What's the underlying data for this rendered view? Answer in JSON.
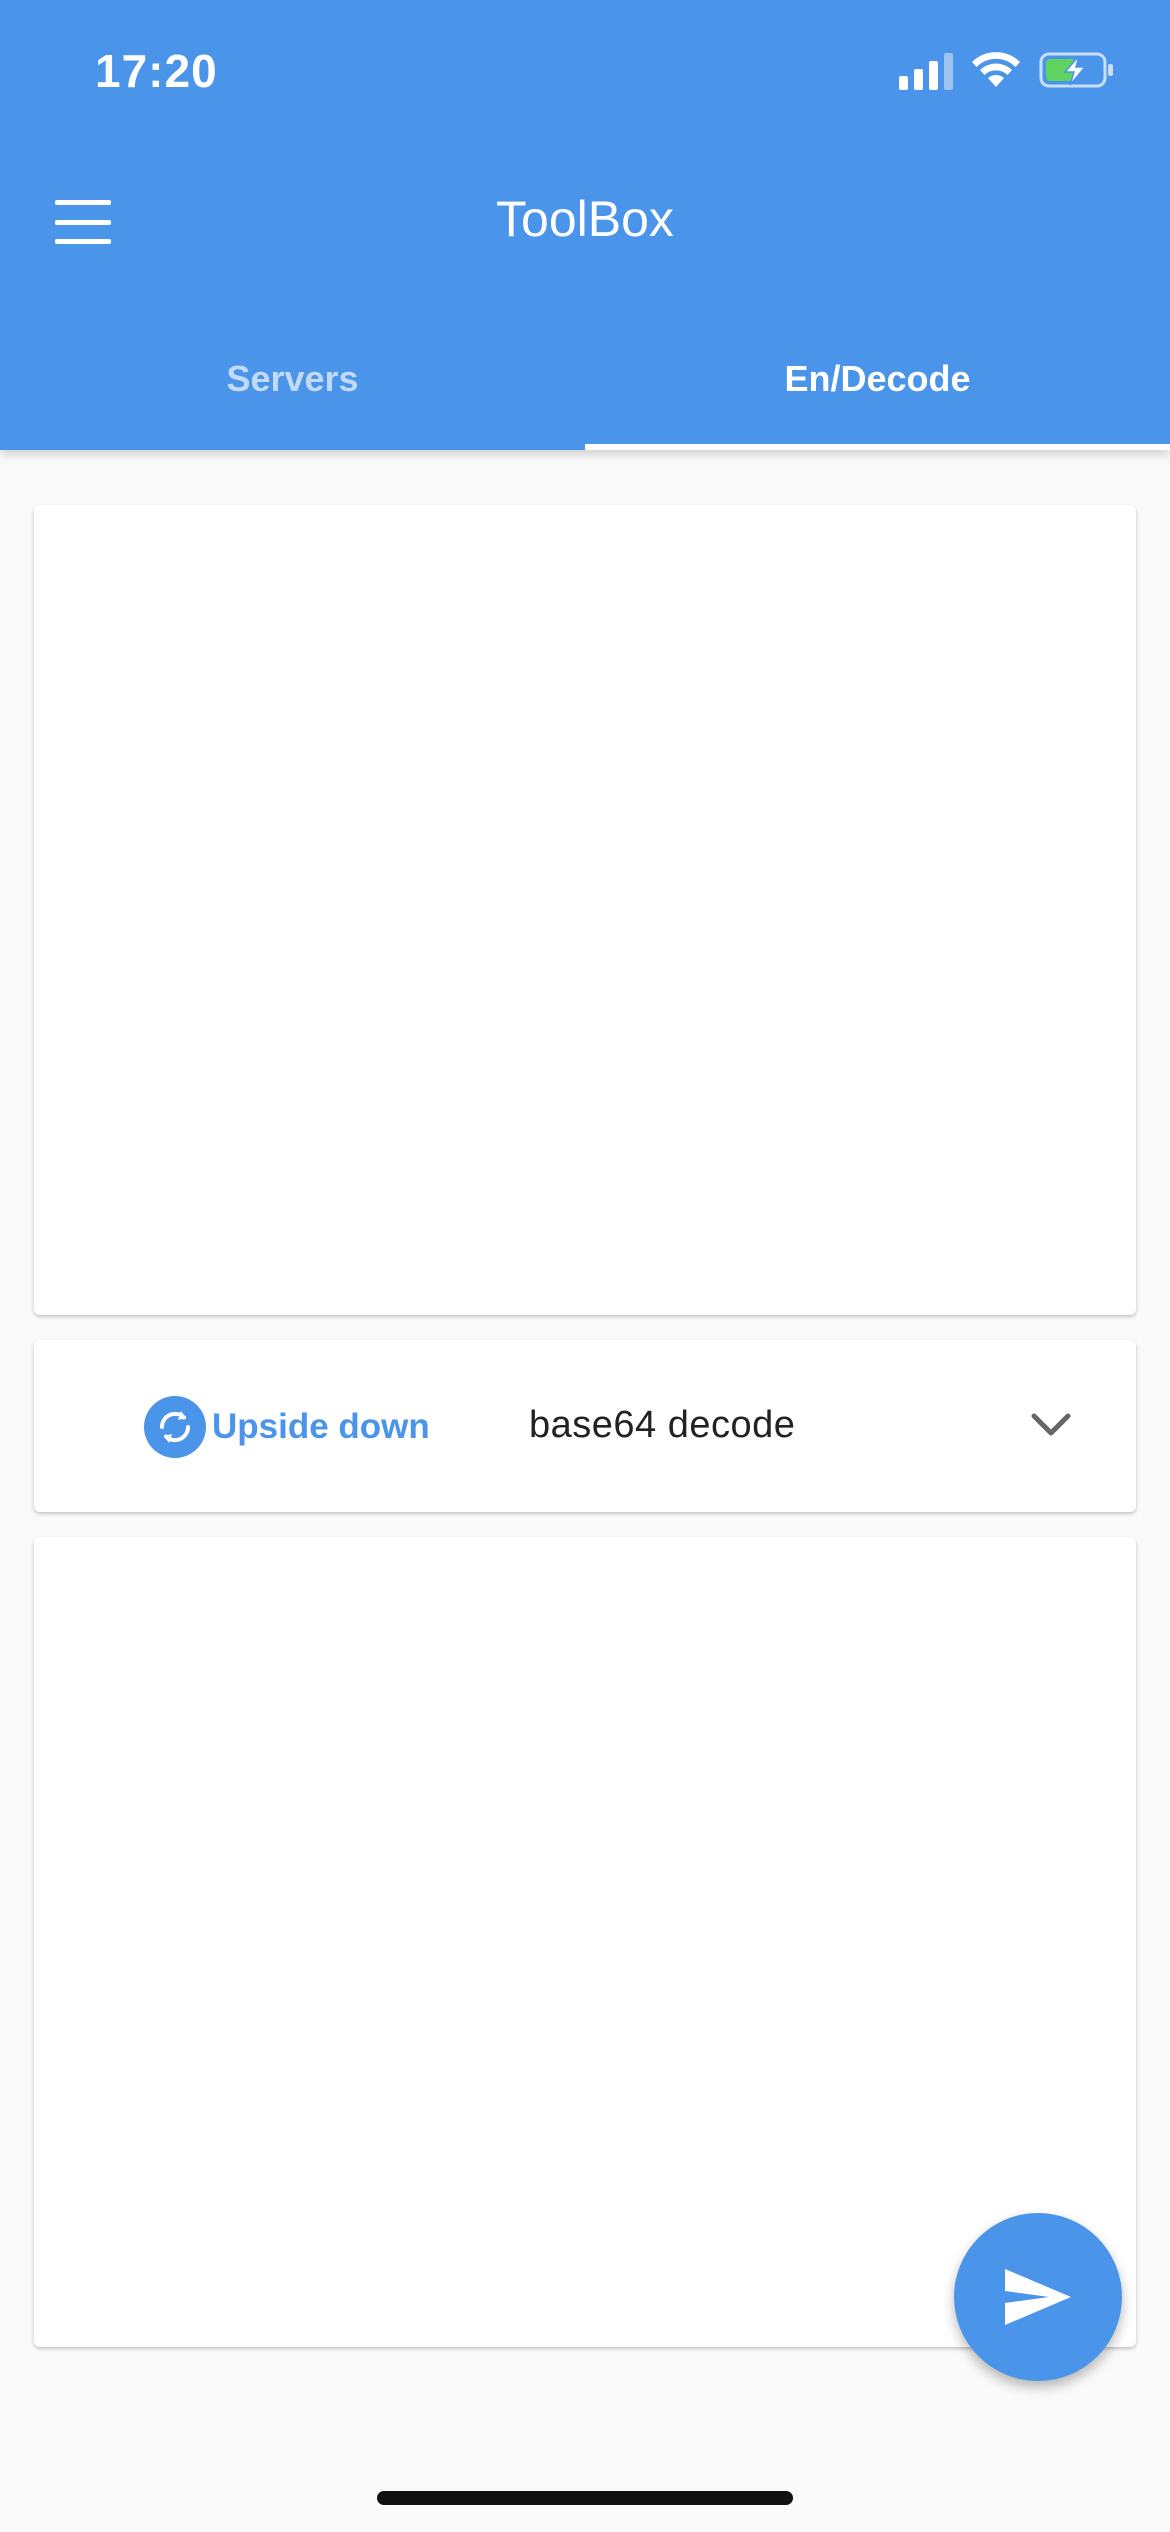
{
  "status_bar": {
    "time": "17:20",
    "icons": [
      "signal-icon",
      "wifi-icon",
      "battery-charging-icon"
    ]
  },
  "app_bar": {
    "menu_icon": "hamburger-menu-icon",
    "title": "ToolBox"
  },
  "tabs": [
    {
      "label": "Servers",
      "active": false
    },
    {
      "label": "En/Decode",
      "active": true
    }
  ],
  "input_card": {
    "value": ""
  },
  "controls": {
    "swap_icon": "swap-rotate-icon",
    "swap_label": "Upside down",
    "mode_selected": "base64 decode",
    "dropdown_icon": "chevron-down-icon"
  },
  "output_card": {
    "value": ""
  },
  "fab": {
    "icon": "send-icon"
  },
  "colors": {
    "primary": "#4a94e9",
    "background": "#fafafa",
    "card": "#ffffff",
    "text": "#222222"
  }
}
